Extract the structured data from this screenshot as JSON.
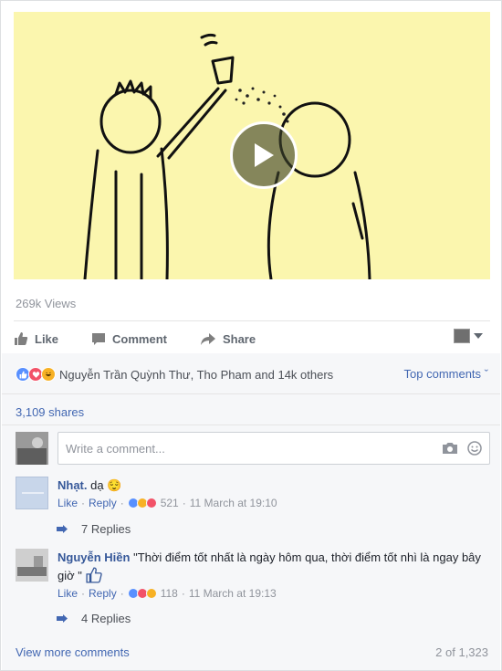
{
  "video": {
    "views": "269k Views"
  },
  "actions": {
    "like": "Like",
    "comment": "Comment",
    "share": "Share"
  },
  "reactions": {
    "summary": "Nguyễn Trần Quỳnh Thư, Tho Pham and 14k others",
    "top_comments": "Top comments ˇ",
    "colors": {
      "like": "#5890ff",
      "love": "#f25268",
      "haha": "#f7b125"
    }
  },
  "shares": "3,109 shares",
  "composer": {
    "placeholder": "Write a comment..."
  },
  "comments": [
    {
      "author": "Nhạt.",
      "text": "dạ",
      "emoji": "😌",
      "like": "Like",
      "reply": "Reply",
      "reaction_count": "521",
      "time": "11 March at 19:10",
      "replies": "7 Replies"
    },
    {
      "author": "Nguyễn Hiền",
      "text": "\"Thời điểm tốt nhất là ngày hôm qua, thời điểm tốt nhì là ngay bây giờ \"",
      "like": "Like",
      "reply": "Reply",
      "reaction_count": "118",
      "time": "11 March at 19:13",
      "replies": "4 Replies"
    }
  ],
  "footer": {
    "view_more": "View more comments",
    "count": "2 of 1,323"
  },
  "icons": [
    "like-icon",
    "comment-icon",
    "share-icon",
    "play-icon",
    "camera-icon",
    "sticker-icon",
    "reply-arrow-icon",
    "thumbs-up-icon"
  ]
}
